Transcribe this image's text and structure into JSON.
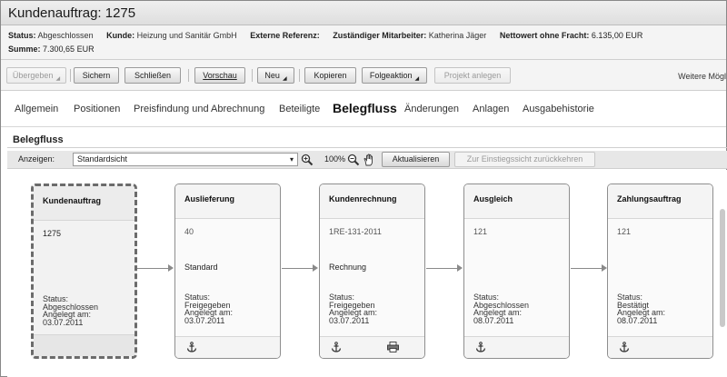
{
  "window": {
    "title": "Kundenauftrag: 1275"
  },
  "info": {
    "status_label": "Status:",
    "status_value": "Abgeschlossen",
    "customer_label": "Kunde:",
    "customer_value": "Heizung und Sanitär GmbH",
    "extref_label": "Externe Referenz:",
    "extref_value": "",
    "employee_label": "Zuständiger Mitarbeiter:",
    "employee_value": "Katherina Jäger",
    "net_label": "Nettowert ohne Fracht:",
    "net_value": "6.135,00",
    "net_currency": "EUR",
    "sum_label": "Summe:",
    "sum_value": "7.300,65",
    "sum_currency": "EUR"
  },
  "toolbar": {
    "pass_on": "Übergeben",
    "save": "Sichern",
    "close": "Schließen",
    "preview": "Vorschau",
    "new": "Neu",
    "copy": "Kopieren",
    "follow_up": "Folgeaktion",
    "create_project": "Projekt anlegen",
    "more": "Weitere Mögl"
  },
  "tabs": [
    {
      "label": "Allgemein"
    },
    {
      "label": "Positionen"
    },
    {
      "label": "Preisfindung und Abrechnung"
    },
    {
      "label": "Beteiligte"
    },
    {
      "label": "Belegfluss",
      "active": true
    },
    {
      "label": "Änderungen"
    },
    {
      "label": "Anlagen"
    },
    {
      "label": "Ausgabehistorie"
    }
  ],
  "section": {
    "title": "Belegfluss"
  },
  "viewbar": {
    "show_label": "Anzeigen:",
    "view_value": "Standardsicht",
    "zoom": "100%",
    "refresh": "Aktualisieren",
    "back_to_entry": "Zur Einstiegssicht zurückkehren"
  },
  "flow": [
    {
      "title": "Kundenauftrag",
      "number": "1275",
      "type": "",
      "status_label": "Status:",
      "status": "Abgeschlossen",
      "created_label": "Angelegt am:",
      "created": "03.07.2011",
      "selected": true,
      "icons": []
    },
    {
      "title": "Auslieferung",
      "number": "40",
      "type": "Standard",
      "status_label": "Status:",
      "status": "Freigegeben",
      "created_label": "Angelegt am:",
      "created": "03.07.2011",
      "icons": [
        "anchor-icon"
      ]
    },
    {
      "title": "Kundenrechnung",
      "number": "1RE-131-2011",
      "type": "Rechnung",
      "status_label": "Status:",
      "status": "Freigegeben",
      "created_label": "Angelegt am:",
      "created": "03.07.2011",
      "icons": [
        "anchor-icon",
        "printer-icon"
      ]
    },
    {
      "title": "Ausgleich",
      "number": "121",
      "type": "",
      "status_label": "Status:",
      "status": "Abgeschlossen",
      "created_label": "Angelegt am:",
      "created": "08.07.2011",
      "icons": [
        "anchor-icon"
      ]
    },
    {
      "title": "Zahlungsauftrag",
      "number": "121",
      "type": "",
      "status_label": "Status:",
      "status": "Bestätigt",
      "created_label": "Angelegt am:",
      "created": "08.07.2011",
      "icons": [
        "anchor-icon"
      ]
    }
  ]
}
